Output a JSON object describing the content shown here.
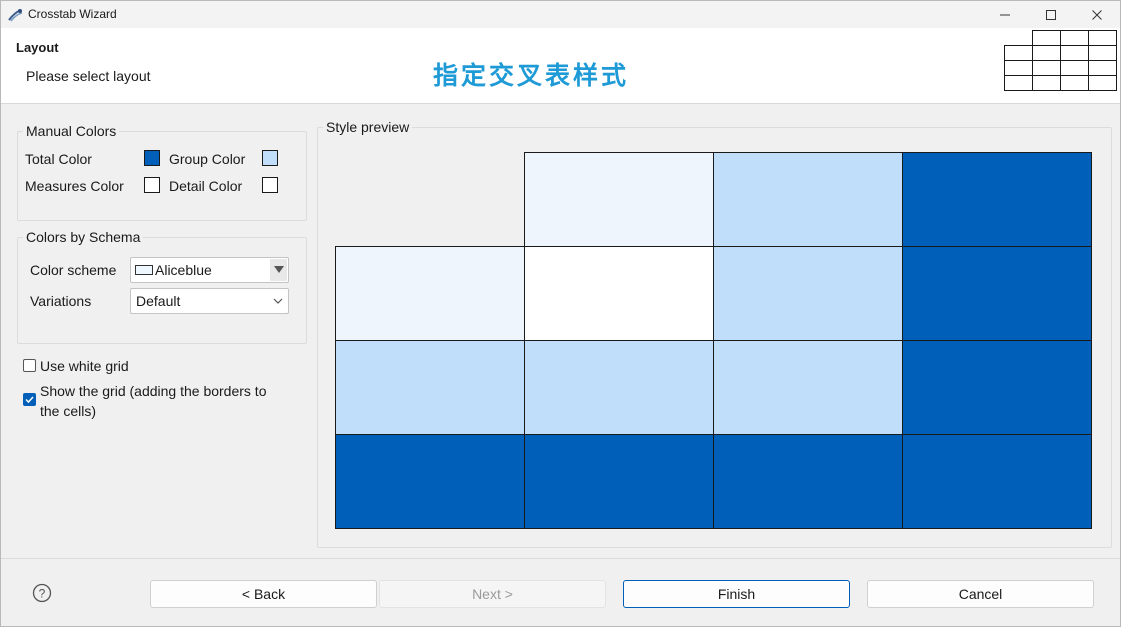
{
  "window": {
    "title": "Crosstab Wizard"
  },
  "header": {
    "title": "Layout",
    "subtitle": "Please select layout",
    "banner": "指定交叉表样式"
  },
  "manual_colors": {
    "legend": "Manual Colors",
    "total_label": "Total Color",
    "total_color": "#005fb8",
    "group_label": "Group Color",
    "group_color": "#c0defa",
    "measures_label": "Measures Color",
    "measures_color": "#ffffff",
    "detail_label": "Detail Color",
    "detail_color": "#ffffff"
  },
  "schema": {
    "legend": "Colors by Schema",
    "scheme_label": "Color scheme",
    "scheme_value": "Aliceblue",
    "scheme_color": "#f0f8ff",
    "variations_label": "Variations",
    "variations_value": "Default"
  },
  "options": {
    "white_grid_label": "Use white grid",
    "white_grid_checked": false,
    "show_grid_label_line1": "Show the grid (adding the borders to",
    "show_grid_label_line2": "the cells)",
    "show_grid_checked": true
  },
  "preview": {
    "legend": "Style preview",
    "cells": [
      [
        "empty",
        "#eef5fd",
        "#c0defa",
        "#005fb8"
      ],
      [
        "#eef5fd",
        "#ffffff",
        "#c0defa",
        "#005fb8"
      ],
      [
        "#c0defa",
        "#c0defa",
        "#c0defa",
        "#005fb8"
      ],
      [
        "#005fb8",
        "#005fb8",
        "#005fb8",
        "#005fb8"
      ]
    ]
  },
  "buttons": {
    "back": "< Back",
    "next": "Next >",
    "finish": "Finish",
    "cancel": "Cancel"
  },
  "icons": {
    "app": "crosstab-wizard-icon",
    "help": "help-icon",
    "minimize": "minimize-icon",
    "maximize": "maximize-icon",
    "close": "close-icon"
  }
}
